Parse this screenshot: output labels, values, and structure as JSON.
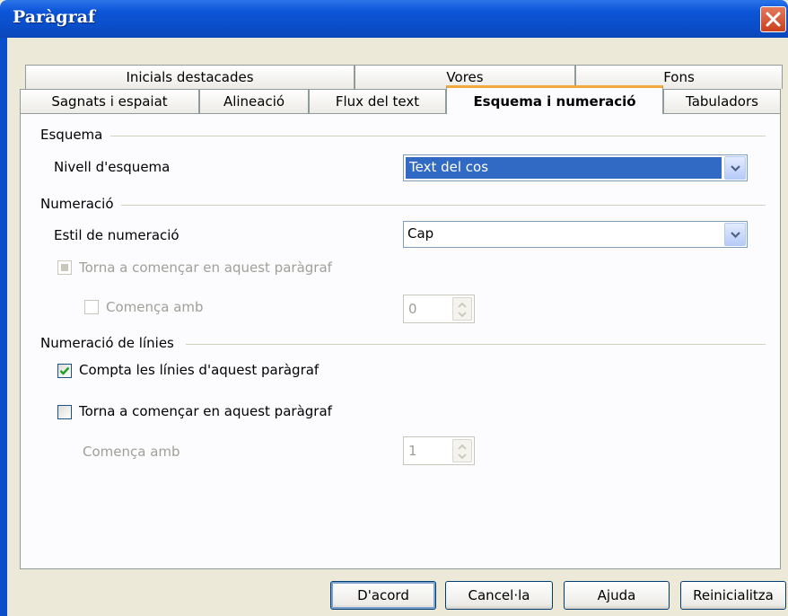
{
  "window": {
    "title": "Paràgraf"
  },
  "tabs_row1": [
    {
      "label": "Inicials destacades"
    },
    {
      "label": "Vores"
    },
    {
      "label": "Fons"
    }
  ],
  "tabs_row2": [
    {
      "label": "Sagnats i espaiat"
    },
    {
      "label": "Alineació"
    },
    {
      "label": "Flux del text"
    },
    {
      "label": "Esquema i numeració"
    },
    {
      "label": "Tabuladors"
    }
  ],
  "outline": {
    "group_title": "Esquema",
    "level_label": "Nivell d'esquema",
    "level_value": "Text del cos"
  },
  "numbering": {
    "group_title": "Numeració",
    "style_label": "Estil de numeració",
    "style_value": "Cap",
    "restart_label": "Torna a començar en aquest paràgraf",
    "start_with_label": "Comença amb",
    "start_with_value": "0"
  },
  "line_numbering": {
    "group_title": "Numeració de línies",
    "count_label": "Compta les línies d'aquest paràgraf",
    "count_checked": true,
    "restart_label": "Torna a començar en aquest paràgraf",
    "restart_checked": false,
    "start_with_label": "Comença amb",
    "start_with_value": "1"
  },
  "buttons": {
    "ok": "D'acord",
    "cancel": "Cancel·la",
    "help": "Ajuda",
    "reset": "Reinicialitza"
  }
}
